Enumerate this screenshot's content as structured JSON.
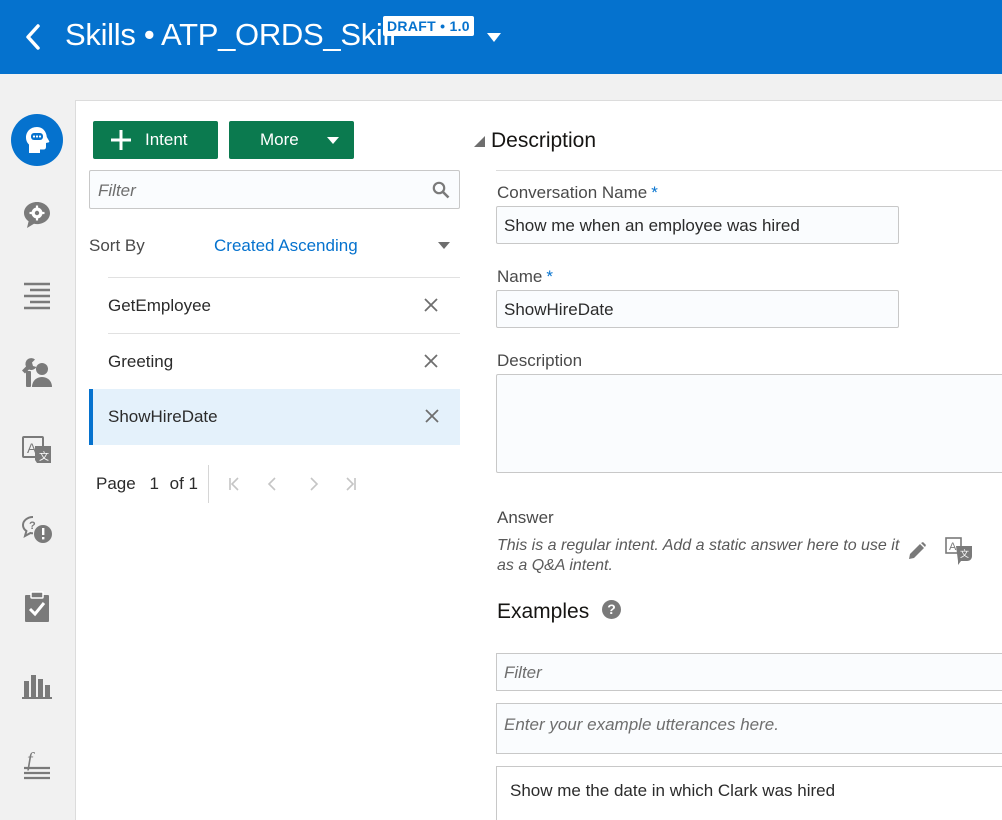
{
  "header": {
    "back_label": "Back",
    "title": "Skills • ATP_ORDS_Skill",
    "badge": "DRAFT • 1.0"
  },
  "rail": {
    "items": [
      "Intents",
      "Entities",
      "Flows",
      "Components",
      "Resource Bundles",
      "Q&A",
      "Quality",
      "Insights",
      "Settings"
    ]
  },
  "toolbar": {
    "intent_label": "Intent",
    "more_label": "More"
  },
  "list": {
    "filter_placeholder": "Filter",
    "sort_by_label": "Sort By",
    "sort_value": "Created Ascending",
    "intents": [
      {
        "name": "GetEmployee"
      },
      {
        "name": "Greeting"
      },
      {
        "name": "ShowHireDate",
        "selected": true
      }
    ],
    "pager": {
      "page_label": "Page",
      "page": "1",
      "of_label": "of 1"
    }
  },
  "form": {
    "section_title": "Description",
    "conversation_name_label": "Conversation Name",
    "conversation_name_value": "Show me when an employee was hired",
    "name_label": "Name",
    "name_value": "ShowHireDate",
    "required_mark": "*",
    "description_label": "Description",
    "description_value": "",
    "answer_label": "Answer",
    "answer_hint": "This is a regular intent. Add a static answer here to use it as a Q&A intent.",
    "examples_title": "Examples",
    "examples_filter_placeholder": "Filter",
    "examples_input_placeholder": "Enter your example utterances here.",
    "examples": [
      "Show me the date in which Clark was hired"
    ]
  },
  "colors": {
    "brand_blue": "#0572ce",
    "button_green": "#0b7a4f",
    "selected_row_bg": "#e4f1fb"
  }
}
